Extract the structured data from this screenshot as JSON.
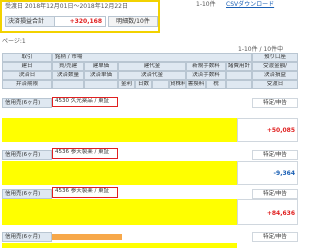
{
  "summary": {
    "period_text": "受渡日 2018年12月01日～2018年12月22日",
    "total_label": "決済損益合計",
    "total_value": "+320,168",
    "detail_button": "明細数/10件",
    "range_text": "1-10件",
    "csv_link": "CSVダウンロード",
    "page_label": "ページ:1",
    "count_label": "1-10件 / 10件中"
  },
  "header": {
    "r1": [
      "取引",
      "銘柄 / 市場",
      "預り口座"
    ],
    "r2": [
      "建日",
      "買/売建",
      "建単価",
      "建代金",
      "新規手数料",
      "諸費用計",
      "受渡金額/"
    ],
    "r3": [
      "決済日",
      "決済数量",
      "決済単価",
      "決済代金",
      "決済手数料",
      "",
      "決済損益"
    ],
    "r4": [
      "弁済期限",
      "",
      "",
      "金利",
      "日数",
      "",
      "貸株料",
      "書換料",
      "税",
      "",
      "受渡日"
    ]
  },
  "rows": [
    {
      "type": "信用売(6ヶ月)",
      "stock": "4530 久光薬品 / 東証",
      "account": "特定/申告",
      "amount": "+50,085",
      "sign": "pos"
    },
    {
      "type": "信用売(6ヶ月)",
      "stock": "4536 参天製薬 / 東証",
      "account": "特定/申告",
      "amount": "-9,364",
      "sign": "neg"
    },
    {
      "type": "信用売(6ヶ月)",
      "stock": "4536 参天製薬 / 東証",
      "account": "特定/申告",
      "amount": "+84,636",
      "sign": "pos"
    },
    {
      "type": "信用売(6ヶ月)",
      "stock": "",
      "account": "特定/申告",
      "amount": "",
      "sign": "pos"
    }
  ],
  "colors": {
    "highlight": "#ffff00",
    "frame": "#e02020",
    "profit": "#e02020",
    "loss": "#1a5fb4"
  }
}
